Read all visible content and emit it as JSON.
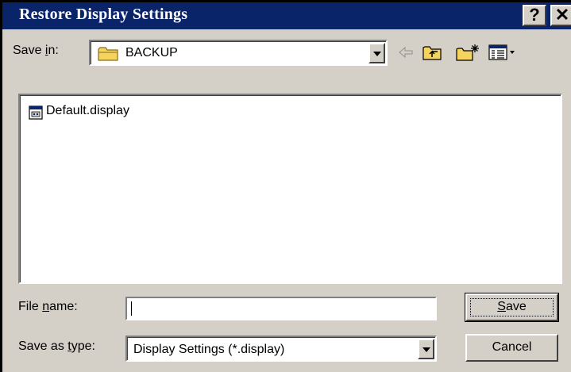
{
  "window": {
    "title": "Restore Display Settings",
    "help_label": "?",
    "close_label": "✕"
  },
  "toolbar": {
    "save_in_label_pre": "Save ",
    "save_in_label_mnemonic": "i",
    "save_in_label_post": "n:",
    "save_in_value": "BACKUP",
    "icons": [
      "folder-icon",
      "back-arrow-icon",
      "up-folder-icon",
      "new-folder-icon",
      "views-menu-icon"
    ]
  },
  "file_list": {
    "items": [
      {
        "name": "Default.display",
        "icon": "display-file-icon"
      }
    ]
  },
  "form": {
    "file_name_label_pre": "File ",
    "file_name_label_mnemonic": "n",
    "file_name_label_post": "ame:",
    "file_name_value": "",
    "save_as_type_label_pre": "Save as ",
    "save_as_type_label_mnemonic": "t",
    "save_as_type_label_post": "ype:",
    "save_as_type_value": "Display Settings (*.display)"
  },
  "buttons": {
    "save_mnemonic": "S",
    "save_rest": "ave",
    "cancel": "Cancel"
  },
  "colors": {
    "titlebar": "#0a246a",
    "face": "#d4d0c8",
    "folder": "#f4d35e"
  }
}
